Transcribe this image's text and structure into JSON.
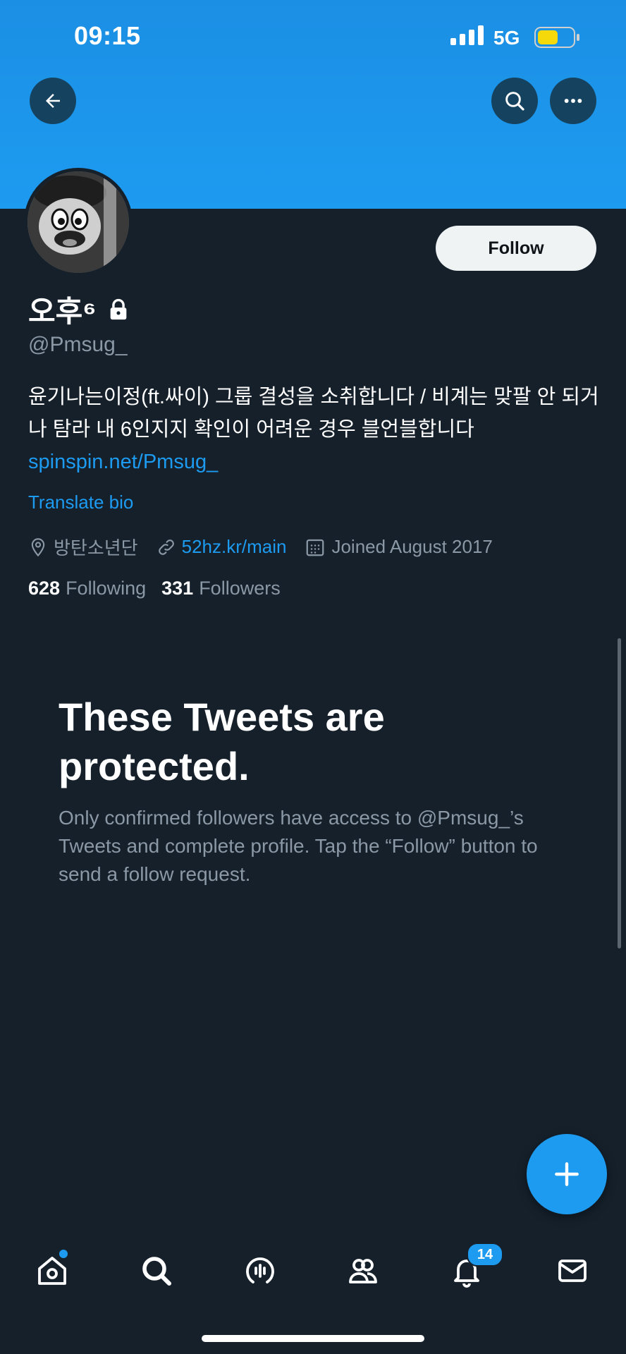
{
  "status_bar": {
    "time": "09:15",
    "network": "5G"
  },
  "profile": {
    "display_name": "오후⁶",
    "handle": "@Pmsug_",
    "bio_text": "윤기나는이정(ft.싸이) 그룹 결성을 소취합니다 / 비계는 맞팔 안 되거나 탐라 내 6인지지 확인이 어려운 경우 블언블합니다",
    "bio_link": "spinspin.net/Pmsug_",
    "translate_label": "Translate bio",
    "location": "방탄소년단",
    "website": "52hz.kr/main",
    "joined": "Joined August 2017",
    "following_count": "628",
    "following_label": "Following",
    "followers_count": "331",
    "followers_label": "Followers",
    "follow_button": "Follow"
  },
  "protected": {
    "title": "These Tweets are protected.",
    "description": "Only confirmed followers have access to @Pmsug_’s Tweets and complete profile. Tap the “Follow” button to send a follow request."
  },
  "tabbar": {
    "notifications_badge": "14"
  },
  "colors": {
    "accent": "#1d9bf0",
    "background": "#15202b",
    "secondary_text": "#8b98a5"
  }
}
